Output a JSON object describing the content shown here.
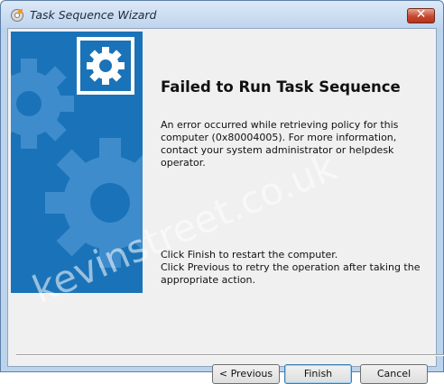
{
  "window": {
    "title": "Task Sequence Wizard",
    "close_label": "✕"
  },
  "content": {
    "heading": "Failed to Run Task Sequence",
    "message": "An error occurred while retrieving policy for this computer (0x80004005). For more information, contact your system administrator or helpdesk operator.",
    "instructions_line1": "Click Finish to restart the computer.",
    "instructions_line2": "Click Previous to retry the operation after taking the appropriate action."
  },
  "banner": {
    "watermark": "kevinstreet.co.uk",
    "icon": "gear-icon",
    "color": "#1a73b8"
  },
  "buttons": {
    "previous": "< Previous",
    "finish": "Finish",
    "cancel": "Cancel"
  }
}
